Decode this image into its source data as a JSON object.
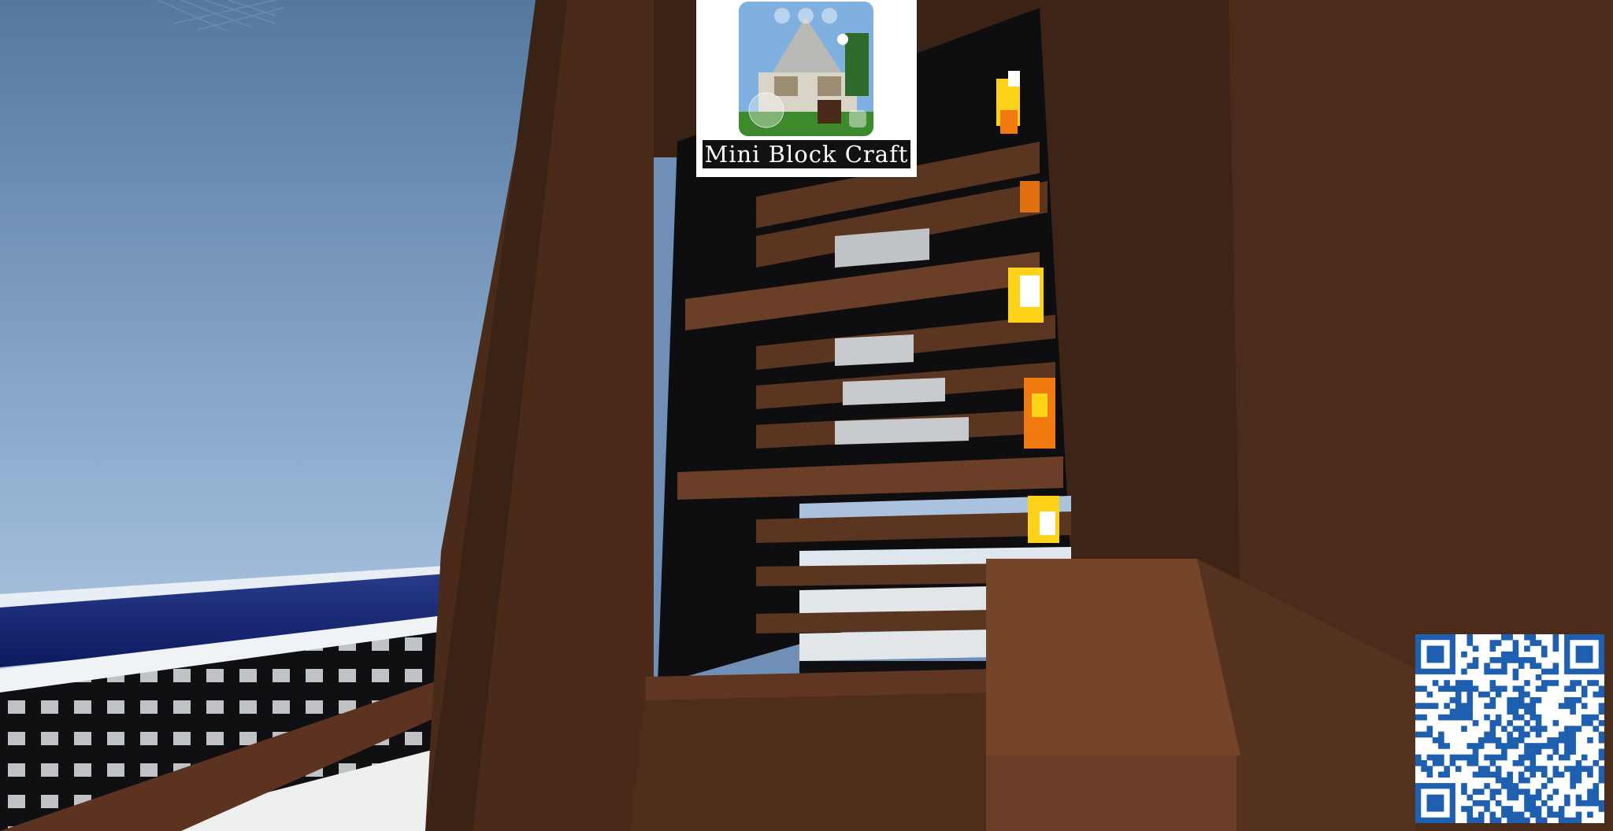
{
  "promo": {
    "title": "Mini Block Craft",
    "thumbnail_icons": [
      "camera-icon",
      "video-icon",
      "settings-icon",
      "joystick-icon",
      "inventory-icon"
    ]
  },
  "hud": {
    "qr_code": "qr-code"
  },
  "colors": {
    "sky_top": "#5f82ab",
    "sky_bottom": "#b9cfe6",
    "ocean": "#1a2a78",
    "wood_dark": "#3e2416",
    "wood_mid": "#5a3520",
    "wood_light": "#6b3f27",
    "shadow": "#0e0e10",
    "fire_yellow": "#ffd21a",
    "fire_orange": "#f07a10",
    "qr_blue": "#1f5fb0"
  }
}
